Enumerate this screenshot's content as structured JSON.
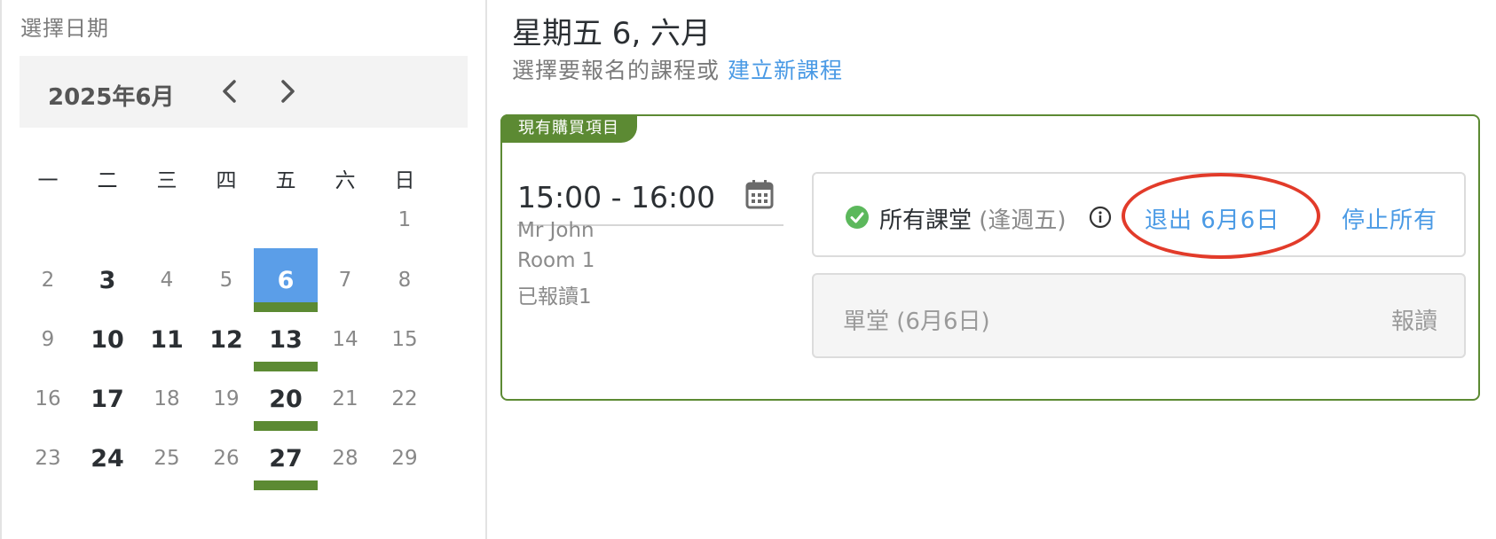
{
  "picker": {
    "title": "選擇日期",
    "month": "2025年6月",
    "weekdays": [
      "一",
      "二",
      "三",
      "四",
      "五",
      "六",
      "日"
    ],
    "days": [
      {
        "label": "1",
        "state": "inactive",
        "class_day": false
      },
      {
        "label": "2",
        "state": "inactive",
        "class_day": false
      },
      {
        "label": "3",
        "state": "active",
        "class_day": false
      },
      {
        "label": "4",
        "state": "inactive",
        "class_day": false
      },
      {
        "label": "5",
        "state": "inactive",
        "class_day": false
      },
      {
        "label": "6",
        "state": "selected",
        "class_day": true
      },
      {
        "label": "7",
        "state": "inactive",
        "class_day": false
      },
      {
        "label": "8",
        "state": "inactive",
        "class_day": false
      },
      {
        "label": "9",
        "state": "inactive",
        "class_day": false
      },
      {
        "label": "10",
        "state": "active",
        "class_day": false
      },
      {
        "label": "11",
        "state": "active",
        "class_day": false
      },
      {
        "label": "12",
        "state": "active",
        "class_day": false
      },
      {
        "label": "13",
        "state": "active",
        "class_day": true
      },
      {
        "label": "14",
        "state": "inactive",
        "class_day": false
      },
      {
        "label": "15",
        "state": "inactive",
        "class_day": false
      },
      {
        "label": "16",
        "state": "inactive",
        "class_day": false
      },
      {
        "label": "17",
        "state": "active",
        "class_day": false
      },
      {
        "label": "18",
        "state": "inactive",
        "class_day": false
      },
      {
        "label": "19",
        "state": "inactive",
        "class_day": false
      },
      {
        "label": "20",
        "state": "active",
        "class_day": true
      },
      {
        "label": "21",
        "state": "inactive",
        "class_day": false
      },
      {
        "label": "22",
        "state": "inactive",
        "class_day": false
      },
      {
        "label": "23",
        "state": "inactive",
        "class_day": false
      },
      {
        "label": "24",
        "state": "active",
        "class_day": false
      },
      {
        "label": "25",
        "state": "inactive",
        "class_day": false
      },
      {
        "label": "26",
        "state": "inactive",
        "class_day": false
      },
      {
        "label": "27",
        "state": "active",
        "class_day": true
      },
      {
        "label": "28",
        "state": "inactive",
        "class_day": false
      },
      {
        "label": "29",
        "state": "inactive",
        "class_day": false
      }
    ]
  },
  "detail": {
    "title": "星期五 6, 六月",
    "subtitle": "選擇要報名的課程或",
    "create_link": "建立新課程"
  },
  "class_card": {
    "tab_label": "現有購買項目",
    "time": "15:00 - 16:00",
    "teacher": "Mr John",
    "room": "Room 1",
    "enrolled": "已報讀1",
    "all_classes_label": "所有課堂",
    "all_classes_note": "(逢週五)",
    "withdraw_label": "退出 6月6日",
    "stop_all_label": "停止所有",
    "single_label": "單堂 (6月6日)",
    "enroll_label": "報讀"
  },
  "colors": {
    "accent_blue": "#4a9ae5",
    "selected_day": "#5b9ee8",
    "class_green": "#5c8a33",
    "annotation_red": "#e23b2a",
    "check_green": "#5cb85c"
  },
  "icons": [
    "chevron-left-icon",
    "chevron-right-icon",
    "calendar-icon",
    "check-circle-icon",
    "info-icon"
  ]
}
